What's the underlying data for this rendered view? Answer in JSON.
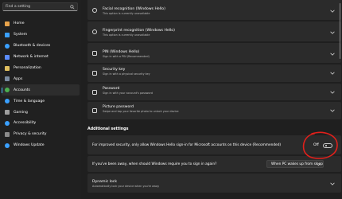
{
  "search": {
    "placeholder": "Find a setting",
    "icon": "search-icon"
  },
  "sidebar": {
    "accent_color": "#4cc2ff",
    "items": [
      {
        "label": "Home",
        "icon": "home-icon",
        "icon_color": "#e8a34b",
        "selected": false
      },
      {
        "label": "System",
        "icon": "system-icon",
        "icon_color": "#3aa0ff",
        "selected": false
      },
      {
        "label": "Bluetooth & devices",
        "icon": "bluetooth-icon",
        "icon_color": "#3aa0ff",
        "selected": false
      },
      {
        "label": "Network & internet",
        "icon": "network-icon",
        "icon_color": "#5b8cff",
        "selected": false
      },
      {
        "label": "Personalization",
        "icon": "brush-icon",
        "icon_color": "#e0c060",
        "selected": false
      },
      {
        "label": "Apps",
        "icon": "apps-icon",
        "icon_color": "#7a8ba0",
        "selected": false
      },
      {
        "label": "Accounts",
        "icon": "person-icon",
        "icon_color": "#4caf50",
        "selected": true
      },
      {
        "label": "Time & language",
        "icon": "clock-icon",
        "icon_color": "#3aa0ff",
        "selected": false
      },
      {
        "label": "Gaming",
        "icon": "gamepad-icon",
        "icon_color": "#9e9e9e",
        "selected": false
      },
      {
        "label": "Accessibility",
        "icon": "accessibility-icon",
        "icon_color": "#3aa0ff",
        "selected": false
      },
      {
        "label": "Privacy & security",
        "icon": "shield-icon",
        "icon_color": "#8a8a8a",
        "selected": false
      },
      {
        "label": "Windows Update",
        "icon": "update-icon",
        "icon_color": "#3aa0ff",
        "selected": false
      }
    ]
  },
  "signin_options": [
    {
      "title": "Facial recognition (Windows Hello)",
      "subtitle": "This option is currently unavailable",
      "icon": "face-icon"
    },
    {
      "title": "Fingerprint recognition (Windows Hello)",
      "subtitle": "This option is currently unavailable",
      "icon": "fingerprint-icon"
    },
    {
      "title": "PIN (Windows Hello)",
      "subtitle": "Sign in with a PIN (Recommended)",
      "icon": "pin-icon"
    },
    {
      "title": "Security key",
      "subtitle": "Sign in with a physical security key",
      "icon": "key-icon"
    },
    {
      "title": "Password",
      "subtitle": "Sign in with your account's password",
      "icon": "password-icon"
    },
    {
      "title": "Picture password",
      "subtitle": "Swipe and tap your favorite photo to unlock your device",
      "icon": "picture-icon"
    }
  ],
  "additional_settings": {
    "heading": "Additional settings",
    "hello_only": {
      "text": "For improved security, only allow Windows Hello sign-in for Microsoft accounts on this device (Recommended)",
      "toggle_label": "Off",
      "toggle_on": false,
      "annotation_color": "#e0201b"
    },
    "require_signin": {
      "text": "If you've been away, when should Windows require you to sign in again?",
      "dropdown_value": "When PC wakes up from sleep"
    },
    "dynamic_lock": {
      "title": "Dynamic lock",
      "subtitle": "Automatically lock your device when you're away"
    }
  }
}
